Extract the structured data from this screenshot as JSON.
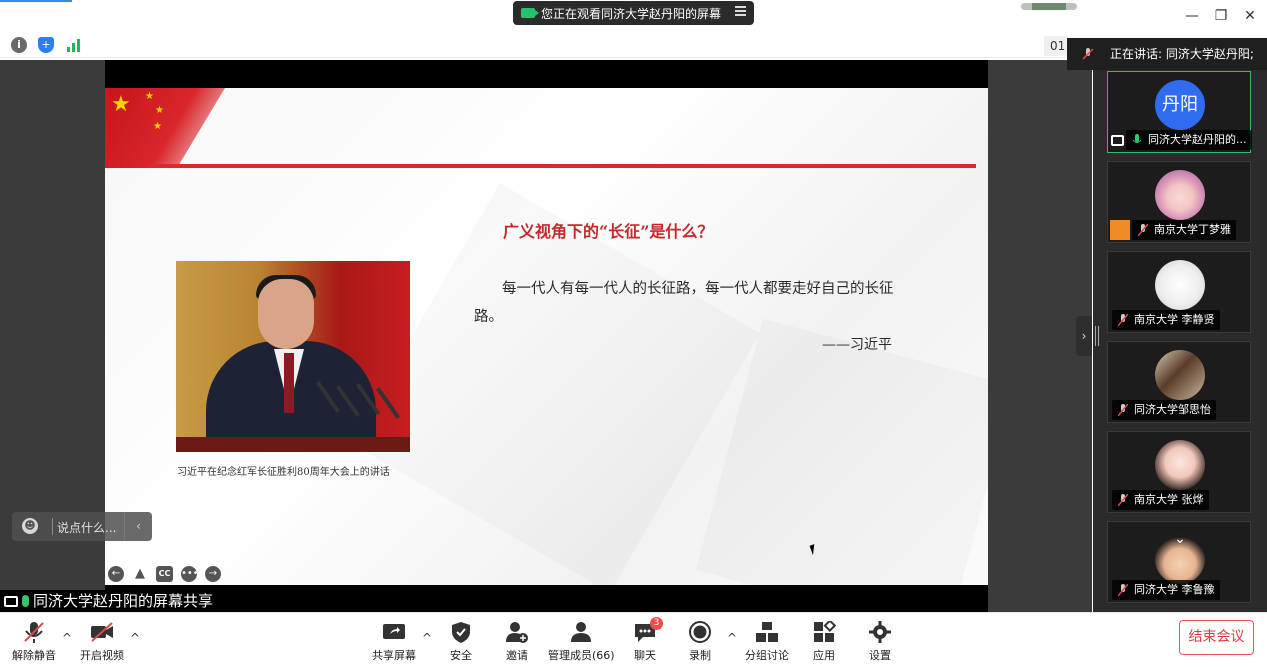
{
  "window": {
    "viewing_banner": "您正在观看同济大学赵丹阳的屏幕",
    "minimize": "—",
    "restore": "❐",
    "close": "✕"
  },
  "infobar": {
    "clock_text": "01"
  },
  "slide": {
    "heading": "广义视角下的“长征”是什么？",
    "quote": "每一代人有每一代人的长征路，每一代人都要走好自己的长征路。",
    "quote_author": "——习近平",
    "photo_caption": "习近平在纪念红军长征胜利80周年大会上的讲话",
    "controls": [
      "←",
      "▲",
      "CC",
      "•••",
      "→"
    ]
  },
  "chat": {
    "placeholder": "说点什么...",
    "collapse": "‹"
  },
  "share_label": "同济大学赵丹阳的屏幕共享",
  "panel": {
    "speaking": "正在讲话: 同济大学赵丹阳;",
    "expand": "›",
    "scroll_down": "⌄",
    "participants": [
      {
        "avatar_text": "丹阳",
        "name": "同济大学赵丹阳的..."
      },
      {
        "avatar_text": "",
        "name": "南京大学丁梦雅"
      },
      {
        "avatar_text": "",
        "name": "南京大学 李静贤"
      },
      {
        "avatar_text": "",
        "name": "同济大学邹思怡"
      },
      {
        "avatar_text": "",
        "name": "南京大学 张烨"
      },
      {
        "avatar_text": "",
        "name": "同济大学 李鲁豫"
      }
    ]
  },
  "toolbar": {
    "unmute": "解除静音",
    "start_video": "开启视频",
    "share_screen": "共享屏幕",
    "security": "安全",
    "invite": "邀请",
    "manage_members": "管理成员(66)",
    "chat": "聊天",
    "chat_badge": "3",
    "record": "录制",
    "breakout": "分组讨论",
    "apps": "应用",
    "settings": "设置",
    "end_meeting": "结束会议",
    "caret": "^"
  },
  "colors": {
    "accent_green": "#2fbf5f",
    "danger_red": "#e03c43",
    "slide_red": "#c6282b",
    "avatar_blue": "#2f6cf0"
  }
}
